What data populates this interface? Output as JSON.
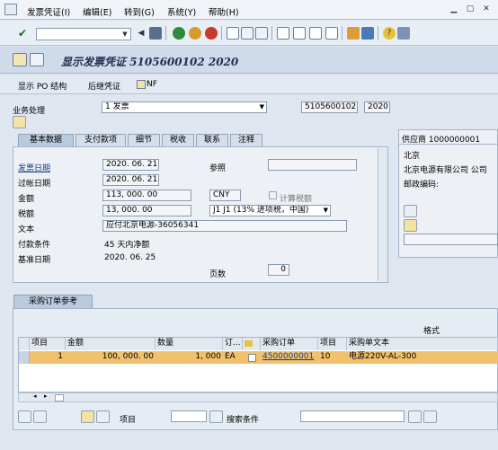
{
  "menu": {
    "items": [
      "发票凭证(I)",
      "编辑(E)",
      "转到(G)",
      "系统(Y)",
      "帮助(H)"
    ]
  },
  "title": "显示发票凭证 5105600102 2020",
  "app_toolbar": {
    "po_structure": "显示 PO 结构",
    "follow_doc": "后继凭证",
    "nf": "NF"
  },
  "transaction": {
    "label": "业务处理",
    "value": "1 发票",
    "doc_number": "5105600102",
    "year": "2020"
  },
  "tabs": [
    "基本数据",
    "支付款项",
    "细节",
    "税收",
    "联系",
    "注释"
  ],
  "basic": {
    "invoice_date_label": "发票日期",
    "invoice_date": "2020. 06. 21",
    "reference_label": "参照",
    "posting_date_label": "过帐日期",
    "posting_date": "2020. 06. 21",
    "amount_label": "金额",
    "amount": "113, 000. 00",
    "currency": "CNY",
    "calc_tax_label": "计算税额",
    "tax_label": "税额",
    "tax": "13, 000. 00",
    "tax_code": "J1 J1 (13% 进项税，中国)",
    "text_label": "文本",
    "text": "应付北京电源-36056341",
    "payment_terms_label": "付款条件",
    "payment_terms": "45 天内净额",
    "baseline_label": "基准日期",
    "baseline": "2020. 06. 25",
    "pages_label": "页数",
    "pages": "0"
  },
  "vendor": {
    "header": "供应商 1000000001",
    "city": "北京",
    "name": "北京电源有限公司 公司",
    "postal_label": "邮政编码:"
  },
  "po_ref_tab": "采购订单参考",
  "grid_format_label": "格式",
  "grid": {
    "headers": [
      "项目",
      "金额",
      "数量",
      "订...",
      "",
      "采购订单",
      "项目",
      "采购单文本"
    ],
    "row": {
      "item": "1",
      "amount": "100, 000. 00",
      "qty": "1, 000",
      "unit": "EA",
      "po": "4500000001",
      "po_item": "10",
      "text": "电源220V-AL-300"
    }
  },
  "bottom": {
    "item_label": "项目",
    "search_label": "搜索条件"
  },
  "colors": {
    "row_highlight": "#f2c16b",
    "link_blue": "#153d8a"
  }
}
